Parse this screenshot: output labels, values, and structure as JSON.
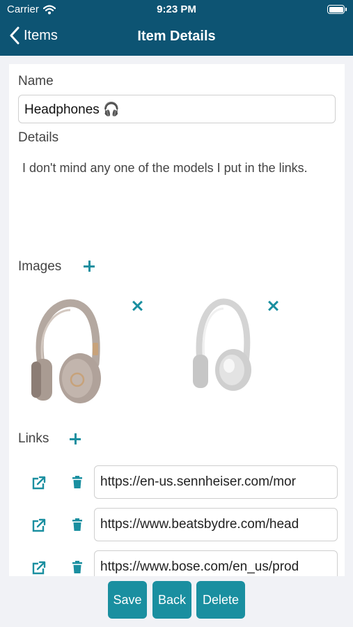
{
  "status_bar": {
    "carrier": "Carrier",
    "time": "9:23 PM"
  },
  "nav": {
    "back_label": "Items",
    "title": "Item Details"
  },
  "form": {
    "name_label": "Name",
    "name_value": "Headphones 🎧",
    "details_label": "Details",
    "details_value": "I don't mind any one of the models I put in the links.",
    "images_label": "Images",
    "links_label": "Links",
    "links": [
      "https://en-us.sennheiser.com/mor",
      "https://www.beatsbydre.com/head",
      "https://www.bose.com/en_us/prod"
    ]
  },
  "buttons": {
    "save": "Save",
    "back": "Back",
    "delete": "Delete"
  },
  "colors": {
    "nav_bar": "#0d5473",
    "accent": "#1a8fa0",
    "background": "#f1f2f6"
  },
  "icons": {
    "back": "chevron-left-icon",
    "add": "plus-icon",
    "remove": "close-icon",
    "open": "external-link-icon",
    "delete": "trash-icon"
  }
}
